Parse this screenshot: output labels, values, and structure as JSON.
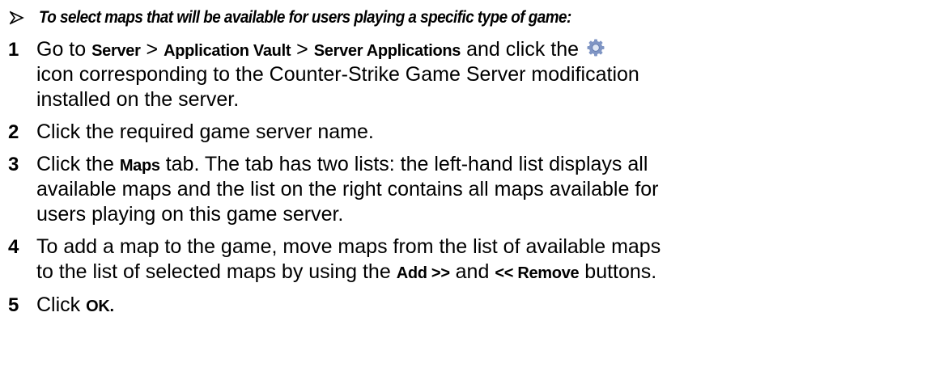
{
  "heading": {
    "bullet_icon": "arrow-bullet-icon",
    "text": "To select maps that will be available for users playing a specific type of game:"
  },
  "steps": [
    {
      "number": "1",
      "lines": [
        {
          "go_to": "Go to ",
          "server": "Server",
          "sep1": " > ",
          "vault": "Application Vault",
          "sep2": " > ",
          "apps": "Server Applications",
          "click_the": " and click the ",
          "icon": "gear-icon"
        },
        {
          "text": "icon corresponding to the Counter-Strike Game Server modification"
        },
        {
          "text": "installed on the server."
        }
      ]
    },
    {
      "number": "2",
      "lines": [
        {
          "text": "Click the required game server name."
        }
      ]
    },
    {
      "number": "3",
      "lines": [
        {
          "click_the": "Click the ",
          "maps": "Maps",
          "rest": " tab. The tab has two lists: the left-hand list displays all"
        },
        {
          "text": "available maps and the list on the right contains all maps available for"
        },
        {
          "text": "users playing on this game server."
        }
      ]
    },
    {
      "number": "4",
      "lines": [
        {
          "text": "To add a map to the game, move maps from the list of available maps"
        },
        {
          "pre": "to the list of selected maps by using the ",
          "add": "Add >>",
          "and": " and ",
          "remove": "<< Remove",
          "post": " buttons."
        }
      ]
    },
    {
      "number": "5",
      "lines": [
        {
          "click": "Click ",
          "ok": "OK."
        }
      ]
    }
  ],
  "colors": {
    "text": "#000000",
    "gear_outer": "#7f95c4",
    "gear_inner": "#dfe7f5"
  }
}
